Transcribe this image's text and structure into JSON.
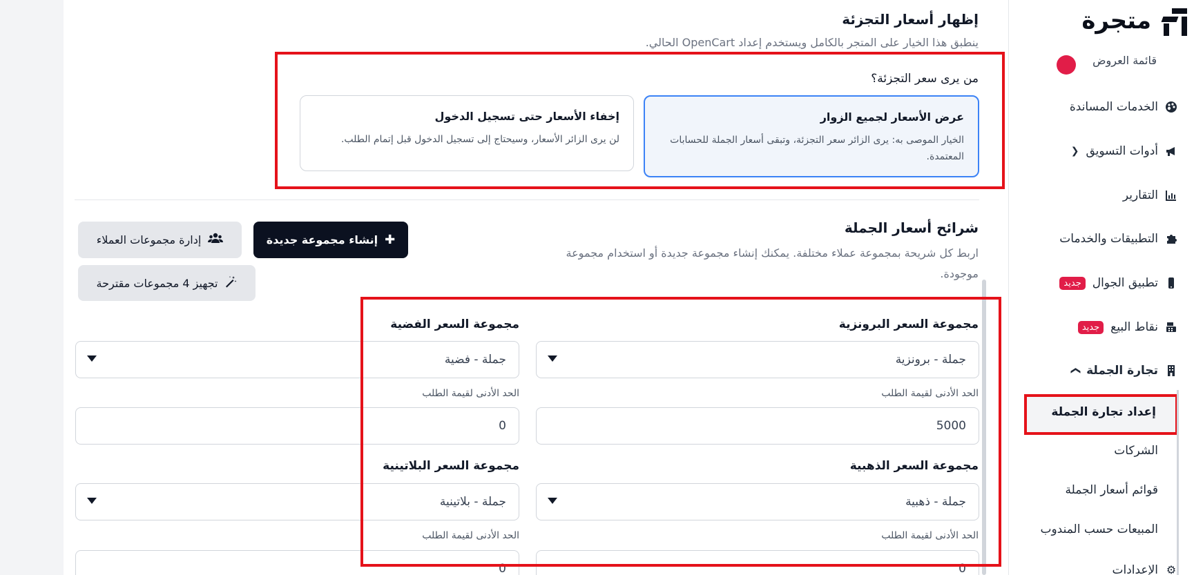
{
  "sidebar": {
    "brand": "متجرة",
    "cut_item": "قائمة العروض",
    "items": [
      {
        "label": "الخدمات المساندة",
        "icon": "palette-icon"
      },
      {
        "label": "أدوات التسويق",
        "icon": "megaphone-icon"
      },
      {
        "label": "التقارير",
        "icon": "chart-icon"
      },
      {
        "label": "التطبيقات والخدمات",
        "icon": "puzzle-icon"
      },
      {
        "label": "تطبيق الجوال",
        "icon": "mobile-icon",
        "badge": "جديد"
      },
      {
        "label": "نقاط البيع",
        "icon": "cash-register-icon",
        "badge": "جديد"
      },
      {
        "label": "تجارة الجملة",
        "icon": "building-icon"
      }
    ],
    "sub_items": [
      "إعداد تجارة الجملة",
      "الشركات",
      "قوائم أسعار الجملة",
      "المبيعات حسب المندوب"
    ],
    "bottom_cut": "الإعدادات"
  },
  "retail": {
    "title": "إظهار أسعار التجزئة",
    "desc": "ينطبق هذا الخيار على المتجر بالكامل ويستخدم إعداد OpenCart الحالي.",
    "question": "من يرى سعر التجزئة؟",
    "option_show": {
      "title": "عرض الأسعار لجميع الزوار",
      "desc": "الخيار الموصى به: يرى الزائر سعر التجزئة، وتبقى أسعار الجملة للحسابات المعتمدة."
    },
    "option_hide": {
      "title": "إخفاء الأسعار حتى تسجيل الدخول",
      "desc": "لن يرى الزائر الأسعار، وسيحتاج إلى تسجيل الدخول قبل إتمام الطلب."
    }
  },
  "tiers": {
    "title": "شرائح أسعار الجملة",
    "desc": "اربط كل شريحة بمجموعة عملاء مختلفة. يمكنك إنشاء مجموعة جديدة أو استخدام مجموعة موجودة.",
    "btn_create": "إنشاء مجموعة جديدة",
    "btn_manage": "إدارة مجموعات العملاء",
    "btn_prepare": "تجهيز 4 مجموعات مقترحة",
    "min_label": "الحد الأدنى لقيمة الطلب",
    "bronze": {
      "label": "مجموعة السعر البرونزية",
      "value": "جملة - برونزية",
      "min": "5000"
    },
    "silver": {
      "label": "مجموعة السعر الفضية",
      "value": "جملة - فضية",
      "min": "0"
    },
    "gold": {
      "label": "مجموعة السعر الذهبية",
      "value": "جملة - ذهبية",
      "min": "0"
    },
    "platinum": {
      "label": "مجموعة السعر البلاتينية",
      "value": "جملة - بلاتينية",
      "min": "0"
    }
  }
}
